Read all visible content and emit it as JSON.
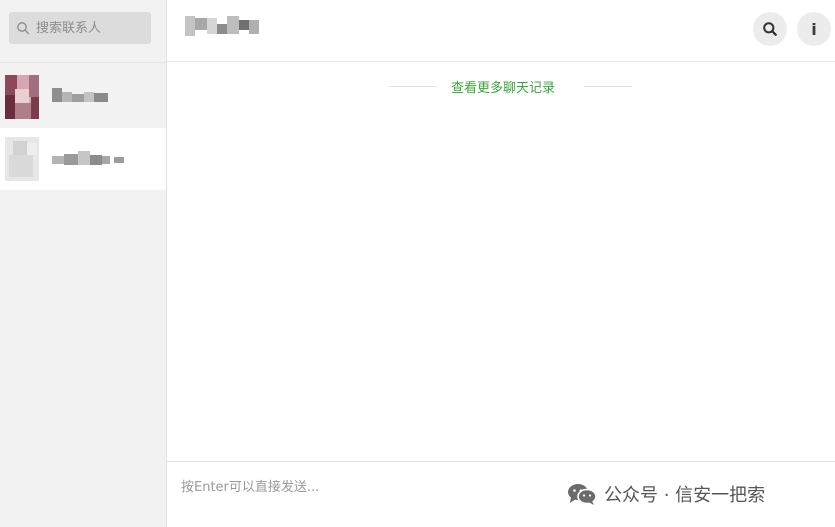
{
  "sidebar": {
    "search": {
      "placeholder": "搜索联系人",
      "icon": "search-icon"
    },
    "contacts": [
      {
        "avatar": "blurred-avatar",
        "name_obscured": true,
        "selected": false
      },
      {
        "avatar": "blurred-avatar",
        "name_obscured": true,
        "selected": true
      }
    ]
  },
  "chat": {
    "title_obscured": true,
    "header_buttons": {
      "search_icon": "search-icon",
      "info_label": "i"
    },
    "history_link": "查看更多聊天记录",
    "composer": {
      "placeholder": "按Enter可以直接发送..."
    }
  },
  "watermark": {
    "text": "公众号 · 信安一把索",
    "icon": "wechat-logo-icon"
  },
  "colors": {
    "sidebar_bg": "#f2f2f2",
    "search_bg": "#dcdcdc",
    "history_link": "#3aa63a",
    "header_button_bg": "#ececec"
  }
}
